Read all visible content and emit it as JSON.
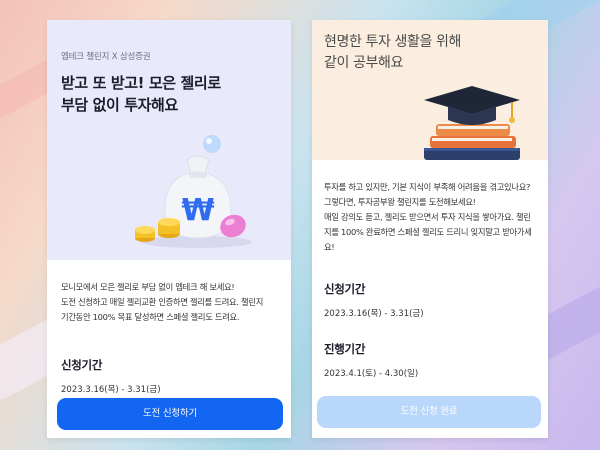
{
  "left_card": {
    "eyebrow": "엡테크 챌린지 X 삼성증권",
    "title_lines": [
      "받고 또 받고! 모은 젤리로",
      "부담 없이 투자해요"
    ],
    "description_lines": [
      "모니모에서 모은 젤리로 부담 없이 엡테크 해 보세요!",
      "도전 신청하고 매일 젤리교환 인증하면 젤리를 드려요. 챌린지",
      "기간동안 100% 목표 달성하면 스페셜 젤리도 드려요."
    ],
    "apply_period": {
      "title": "신청기간",
      "value": "2023.3.16(목) - 3.31(금)"
    },
    "cta_label": "도전 신청하기"
  },
  "right_card": {
    "title_lines": [
      "현명한 투자 생활을 위해",
      "같이 공부해요"
    ],
    "description_lines": [
      "투자를 하고 있지만, 기본 지식이 부족해 어려움을 겪고있나요?",
      "그렇다면, 투자공부왕 챌린지를 도전해보세요!",
      "매일 강의도 듣고, 젤리도 받으면서 투자 지식을 쌓아가요. 챌린",
      "지를 100% 완료하면 스페셜 젤리도 드리니 잊지말고 받아가세",
      "요!"
    ],
    "apply_period": {
      "title": "신청기간",
      "value": "2023.3.16(목) - 3.31(금)"
    },
    "progress_period": {
      "title": "진행기간",
      "value": "2023.4.1(토) - 4.30(일)"
    },
    "cta_label": "도전 신청 완료"
  },
  "colors": {
    "primary_button": "#1266f1",
    "disabled_button": "#b9d6fb",
    "left_hero_bg": "#e8e9fb",
    "right_hero_bg": "#fbeee0"
  },
  "icons": [
    "money-bag-won-icon",
    "gold-coins-icon",
    "jelly-candy-icon",
    "graduation-cap-icon",
    "books-stack-icon"
  ]
}
